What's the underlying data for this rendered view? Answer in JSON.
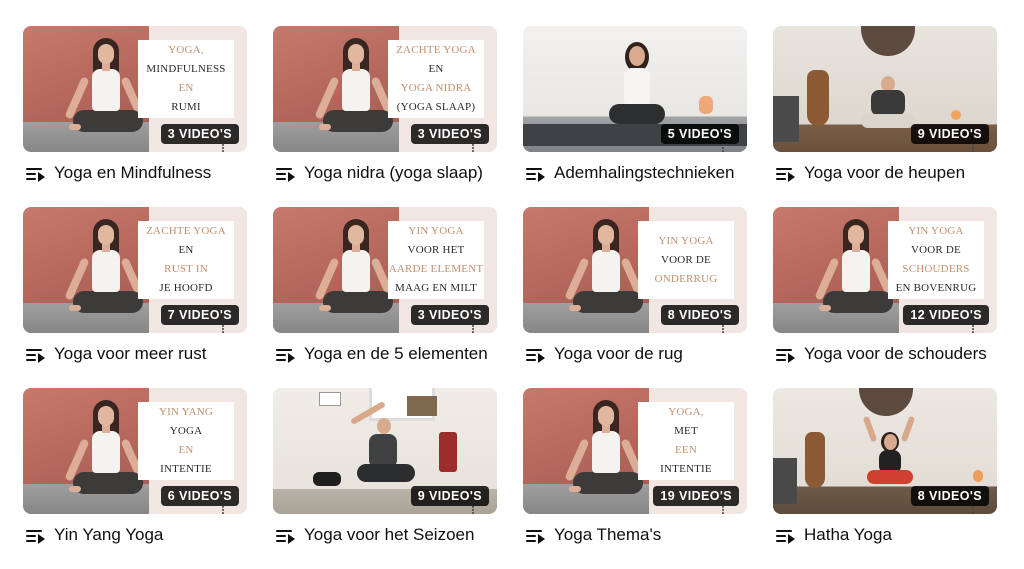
{
  "playlists": [
    {
      "title": "Yoga en Mindfulness",
      "count": "3 VIDEO'S",
      "style": "poster",
      "lines": [
        [
          "YOGA,",
          "accent"
        ],
        [
          "MINDFULNESS",
          "dark"
        ],
        [
          "EN",
          "accent"
        ],
        [
          "RUMI",
          "dark"
        ]
      ]
    },
    {
      "title": "Yoga nidra (yoga slaap)",
      "count": "3 VIDEO'S",
      "style": "poster",
      "lines": [
        [
          "ZACHTE YOGA",
          "accent"
        ],
        [
          "EN",
          "dark"
        ],
        [
          "YOGA NIDRA",
          "accent"
        ],
        [
          "(YOGA SLAAP)",
          "dark"
        ]
      ]
    },
    {
      "title": "Ademhalingstechnieken",
      "count": "5 VIDEO'S",
      "style": "photo1",
      "lines": []
    },
    {
      "title": "Yoga voor de heupen",
      "count": "9 VIDEO'S",
      "style": "photo2",
      "lines": []
    },
    {
      "title": "Yoga voor meer rust",
      "count": "7 VIDEO'S",
      "style": "poster",
      "lines": [
        [
          "ZACHTE YOGA",
          "accent"
        ],
        [
          "EN",
          "dark"
        ],
        [
          "RUST IN",
          "accent"
        ],
        [
          "JE HOOFD",
          "dark"
        ]
      ]
    },
    {
      "title": "Yoga en de 5 elementen",
      "count": "3 VIDEO'S",
      "style": "poster",
      "lines": [
        [
          "YIN YOGA",
          "accent"
        ],
        [
          "VOOR HET",
          "dark"
        ],
        [
          "AARDE ELEMENT",
          "accent"
        ],
        [
          "MAAG EN MILT",
          "dark"
        ]
      ]
    },
    {
      "title": "Yoga voor de rug",
      "count": "8 VIDEO'S",
      "style": "poster",
      "lines": [
        [
          "YIN YOGA",
          "accent"
        ],
        [
          "VOOR DE",
          "dark"
        ],
        [
          "ONDERRUG",
          "accent"
        ]
      ]
    },
    {
      "title": "Yoga voor de schouders",
      "count": "12 VIDEO'S",
      "style": "poster",
      "lines": [
        [
          "YIN YOGA",
          "accent"
        ],
        [
          "VOOR DE",
          "dark"
        ],
        [
          "SCHOUDERS",
          "accent"
        ],
        [
          "EN BOVENRUG",
          "dark"
        ]
      ]
    },
    {
      "title": "Yin Yang Yoga",
      "count": "6 VIDEO'S",
      "style": "poster",
      "lines": [
        [
          "YIN YANG",
          "accent"
        ],
        [
          "YOGA",
          "dark"
        ],
        [
          "EN",
          "accent"
        ],
        [
          "INTENTIE",
          "dark"
        ]
      ]
    },
    {
      "title": "Yoga voor het Seizoen",
      "count": "9 VIDEO'S",
      "style": "photo3",
      "lines": []
    },
    {
      "title": "Yoga Thema's",
      "count": "19 VIDEO'S",
      "style": "poster",
      "lines": [
        [
          "YOGA,",
          "accent"
        ],
        [
          "MET",
          "dark"
        ],
        [
          "EEN",
          "accent"
        ],
        [
          "INTENTIE",
          "dark"
        ]
      ]
    },
    {
      "title": "Hatha Yoga",
      "count": "8 VIDEO'S",
      "style": "photo4",
      "lines": []
    }
  ],
  "colors": {
    "accent": "#c2906f",
    "badge_bg": "#000000",
    "title": "#0f0f0f"
  },
  "icons": {
    "playlist": "playlist-play-icon",
    "more": "more-vert-icon"
  }
}
